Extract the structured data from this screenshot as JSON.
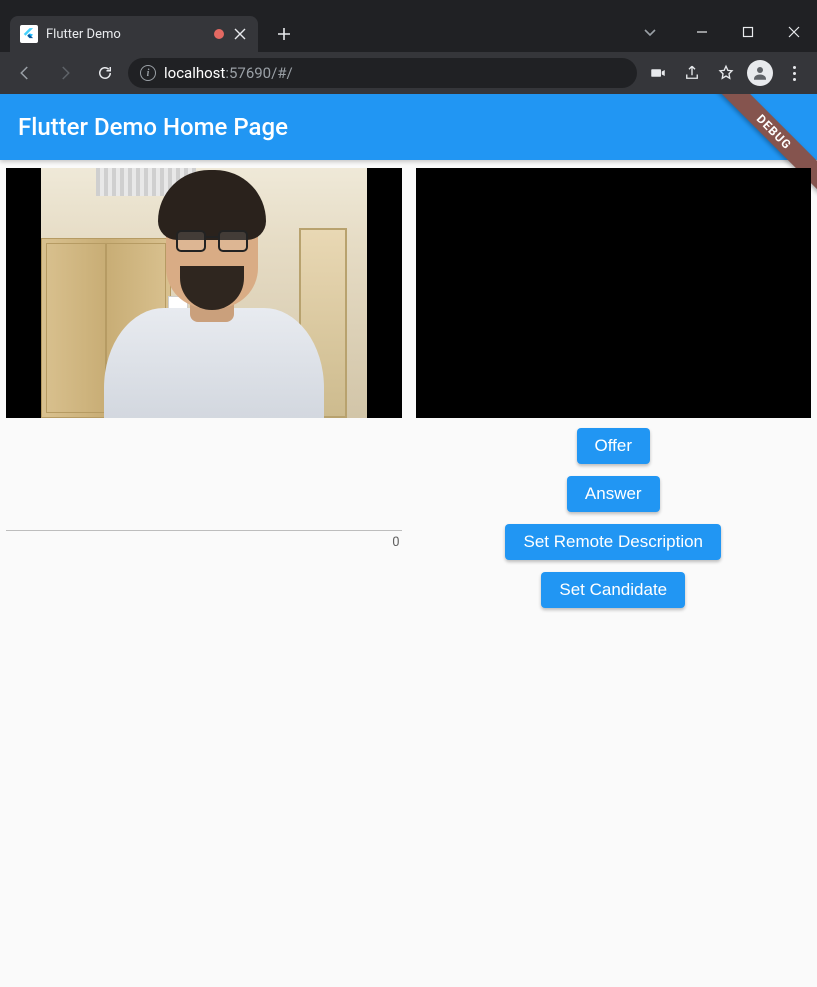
{
  "browser": {
    "tab_title": "Flutter Demo",
    "url_host": "localhost",
    "url_rest": ":57690/#/"
  },
  "app": {
    "title": "Flutter Demo Home Page",
    "debug_label": "DEBUG"
  },
  "left": {
    "textfield_counter": "0"
  },
  "buttons": {
    "offer": "Offer",
    "answer": "Answer",
    "set_remote_description": "Set Remote Description",
    "set_candidate": "Set Candidate"
  }
}
